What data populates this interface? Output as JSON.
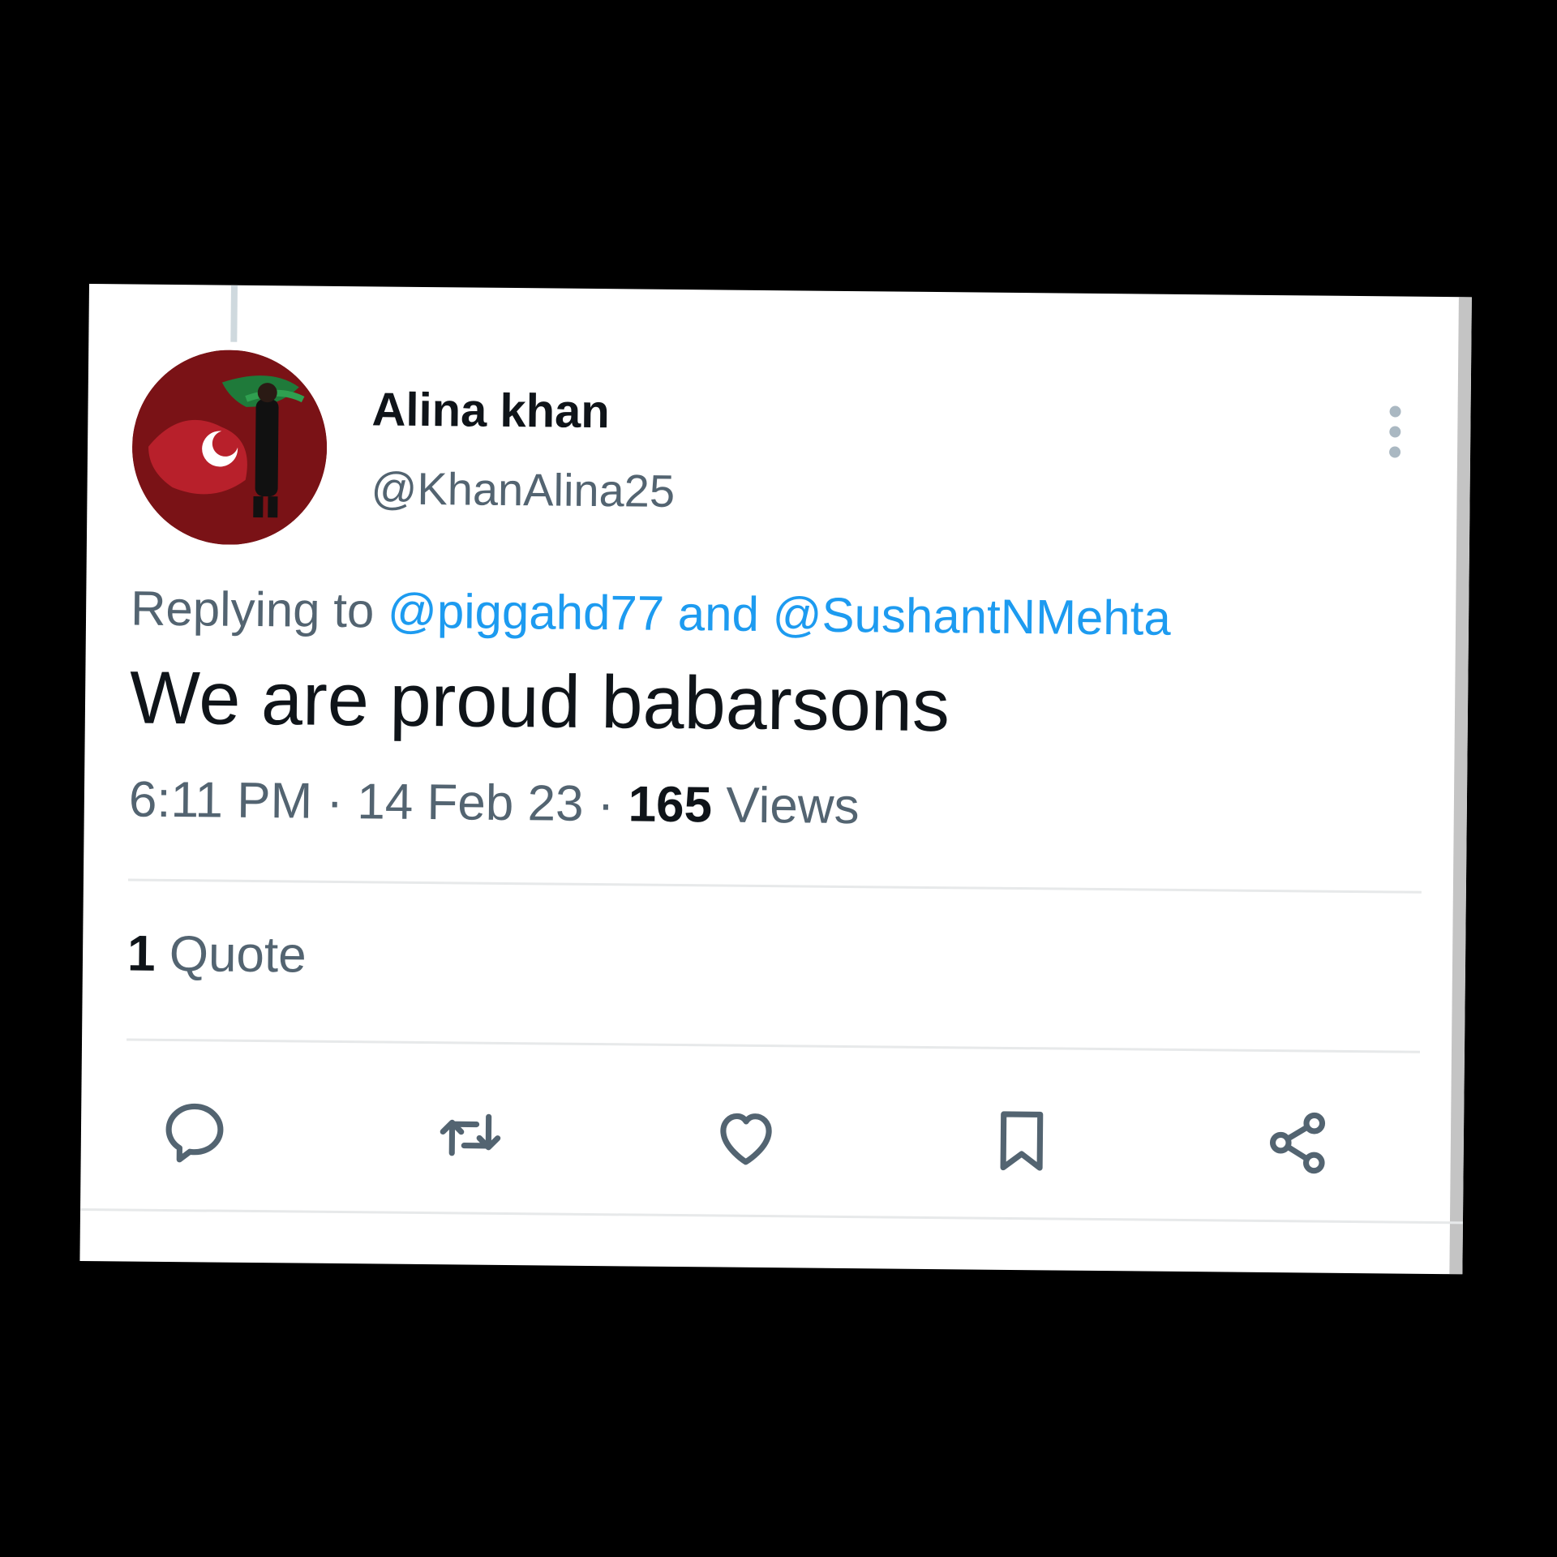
{
  "tweet": {
    "author_name": "Alina khan",
    "author_handle": "@KhanAlina25",
    "replying_prefix": "Replying to",
    "replying_to_1": "@piggahd77",
    "replying_joiner": "and",
    "replying_to_2": "@SushantNMehta",
    "text": "We are proud babarsons",
    "time": "6:11 PM",
    "separator": "·",
    "date": "14 Feb 23",
    "views_count": "165",
    "views_label": "Views",
    "quotes_count": "1",
    "quotes_label": "Quote"
  },
  "actions": [
    {
      "name": "reply",
      "icon": "reply-icon"
    },
    {
      "name": "retweet",
      "icon": "retweet-icon"
    },
    {
      "name": "like",
      "icon": "heart-icon"
    },
    {
      "name": "bookmark",
      "icon": "bookmark-icon"
    },
    {
      "name": "share",
      "icon": "share-icon"
    }
  ],
  "colors": {
    "background": "#000000",
    "card": "#ffffff",
    "text_primary": "#0f1419",
    "text_secondary": "#536471",
    "link": "#1d9bf0",
    "divider": "#e7e9ea",
    "icon": "#536471"
  }
}
